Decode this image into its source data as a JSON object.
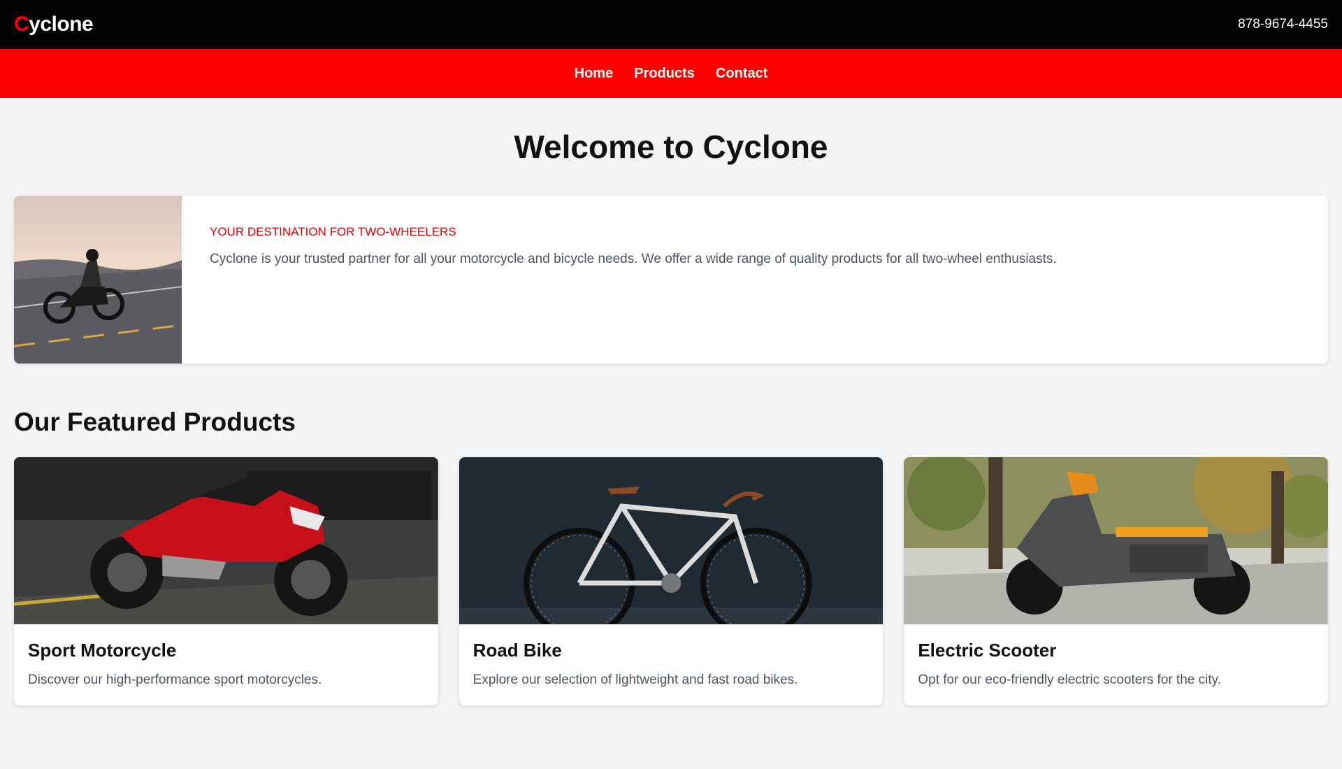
{
  "header": {
    "logo_first_letter": "C",
    "logo_rest": "yclone",
    "phone": "878-9674-4455"
  },
  "nav": {
    "items": [
      "Home",
      "Products",
      "Contact"
    ]
  },
  "hero": {
    "title": "Welcome to Cyclone"
  },
  "intro": {
    "tag": "YOUR DESTINATION FOR TWO-WHEELERS",
    "description": "Cyclone is your trusted partner for all your motorcycle and bicycle needs. We offer a wide range of quality products for all two-wheel enthusiasts.",
    "image_icon": "motorcycle-rider-photo"
  },
  "featured": {
    "title": "Our Featured Products",
    "products": [
      {
        "name": "Sport Motorcycle",
        "description": "Discover our high-performance sport motorcycles.",
        "image_icon": "sport-motorcycle-photo"
      },
      {
        "name": "Road Bike",
        "description": "Explore our selection of lightweight and fast road bikes.",
        "image_icon": "road-bike-photo"
      },
      {
        "name": "Electric Scooter",
        "description": "Opt for our eco-friendly electric scooters for the city.",
        "image_icon": "electric-scooter-photo"
      }
    ]
  },
  "colors": {
    "brand_red": "#ff0000",
    "topbar": "#000000",
    "background": "#f3f4f6"
  }
}
